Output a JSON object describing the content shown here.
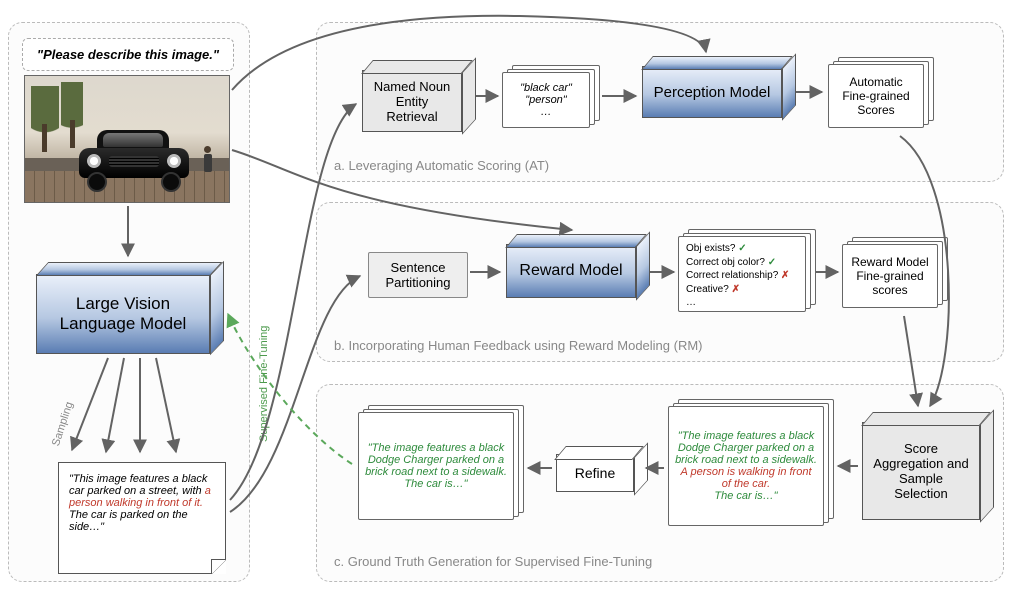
{
  "prompt": "\"Please describe this image.\"",
  "vlm_label": "Large Vision Language Model",
  "sampling_label": "Sampling",
  "sft_label": "Supervised Fine-Tuning",
  "sample_output": {
    "pre": "\"This image features a black car parked on a street, with ",
    "red": "a person walking in front of it.",
    "post": " The car is parked on the side…\""
  },
  "panel_a": {
    "caption": "a. Leveraging Automatic Scoring (AT)",
    "nner": "Named Noun Entity Retrieval",
    "entities": "\"black car\"\n\"person\"\n…",
    "perception": "Perception Model",
    "scores": "Automatic Fine-grained Scores"
  },
  "panel_b": {
    "caption": "b. Incorporating Human Feedback using Reward Modeling (RM)",
    "partition": "Sentence Partitioning",
    "reward": "Reward Model",
    "checks": {
      "l1": "Obj exists?",
      "l2": "Correct obj color?",
      "l3": "Correct relationship?",
      "l4": "Creative?",
      "mark_ok": "✓",
      "mark_no": "✗",
      "dots": "…"
    },
    "scores": "Reward Model Fine-grained scores"
  },
  "panel_c": {
    "caption": "c. Ground Truth Generation for Supervised Fine-Tuning",
    "agg": "Score Aggregation and Sample Selection",
    "refine": "Refine",
    "after_refine": {
      "g1": "\"The image features a black Dodge Charger parked on a brick road next to a sidewalk.",
      "g2": " The car is…\""
    },
    "before_refine": {
      "g1": "\"The image features a black Dodge Charger parked on a brick road next to a sidewalk.",
      "r1": " A person is walking in front of the car.",
      "g2": " The car is…\""
    }
  }
}
